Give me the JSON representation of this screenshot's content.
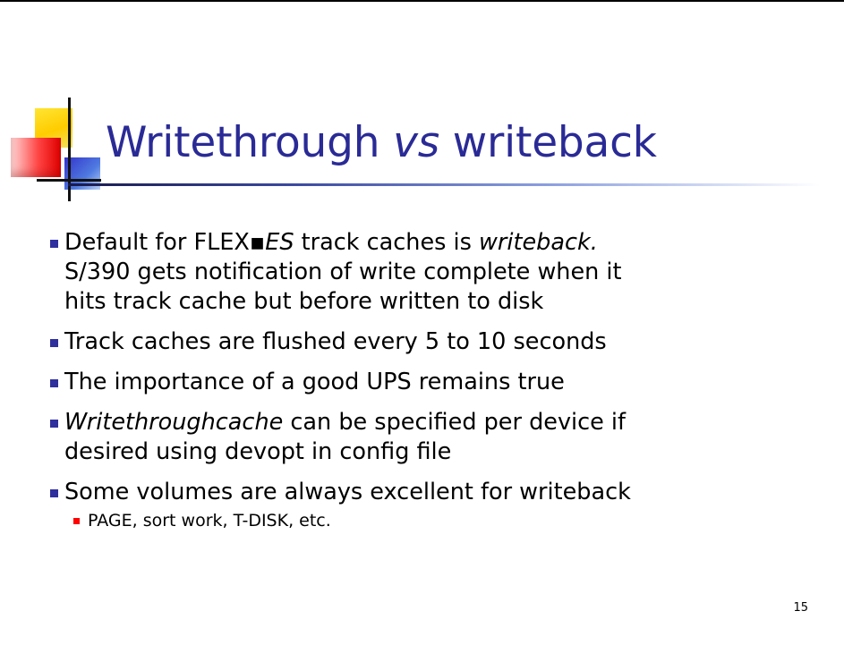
{
  "slide": {
    "title": {
      "before": "Writethrough ",
      "italic": "vs",
      "after": " writeback"
    },
    "bullets": [
      {
        "parts": [
          {
            "text": "Default for FLEX",
            "italic": false
          },
          {
            "text": "▪",
            "italic": false
          },
          {
            "text": "ES",
            "italic": true
          },
          {
            "text": " track caches is ",
            "italic": false
          },
          {
            "text": "writeback.",
            "italic": true
          }
        ],
        "line2": "S/390 gets notification of write complete when it",
        "line3": "hits track cache but before written to disk"
      },
      {
        "text": "Track caches are flushed every 5 to 10 seconds"
      },
      {
        "text": "The importance of a good UPS remains true"
      },
      {
        "italic_lead": "Writethroughcache",
        "rest": " can be specified per device if",
        "line2": "desired using devopt in config file"
      },
      {
        "text": "Some volumes are always excellent for writeback",
        "sub": [
          "PAGE, sort work, T-DISK, etc."
        ]
      }
    ],
    "page_number": "15"
  },
  "colors": {
    "title": "#2a2a96",
    "bullet_square": "#2f2f9e",
    "sub_bullet_square": "#ff0000"
  }
}
